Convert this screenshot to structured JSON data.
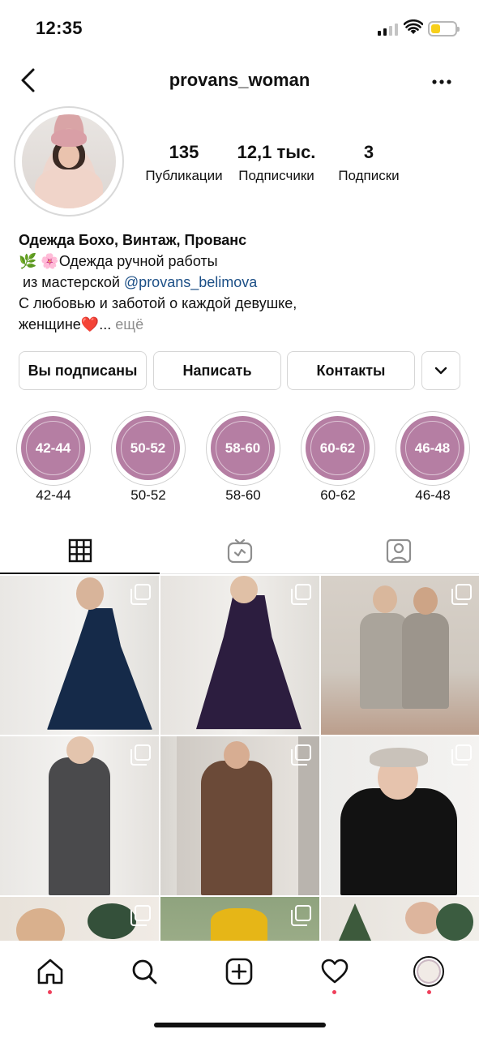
{
  "status_bar": {
    "time": "12:35"
  },
  "header": {
    "username": "provans_woman"
  },
  "stats": [
    {
      "value": "135",
      "label": "Публикации"
    },
    {
      "value": "12,1 тыс.",
      "label": "Подписчики"
    },
    {
      "value": "3",
      "label": "Подписки"
    }
  ],
  "bio": {
    "name": "Одежда Бохо, Винтаж, Прованс",
    "line1_emoji": "🌿 🌸",
    "line1_text": "Одежда ручной работы",
    "line2_text": " из мастерской ",
    "line2_mention": "@provans_belimova",
    "line3": "С любовью и заботой о каждой девушке,",
    "line4_text": "женщине",
    "line4_emoji": "❤️",
    "line4_ellipsis": "... ",
    "more": "ещё"
  },
  "buttons": {
    "following": "Вы подписаны",
    "message": "Написать",
    "contacts": "Контакты"
  },
  "highlights": [
    {
      "title": "42-44",
      "label": "42-44"
    },
    {
      "title": "50-52",
      "label": "50-52"
    },
    {
      "title": "58-60",
      "label": "58-60"
    },
    {
      "title": "60-62",
      "label": "60-62"
    },
    {
      "title": "46-48",
      "label": "46-48"
    }
  ],
  "tabs": [
    "grid-icon",
    "igtv-icon",
    "tagged-icon"
  ],
  "posts": [
    {
      "desc": "navy velvet dress",
      "multi": true
    },
    {
      "desc": "purple velvet dress",
      "multi": true
    },
    {
      "desc": "two women checked dresses",
      "multi": true
    },
    {
      "desc": "grey knit top and skirt",
      "multi": true
    },
    {
      "desc": "brown dress mirror selfie",
      "multi": true
    },
    {
      "desc": "black sweater and cap",
      "multi": true
    },
    {
      "desc": "christmas wreath portrait",
      "multi": true
    },
    {
      "desc": "yellow top",
      "multi": true
    },
    {
      "desc": "woman with christmas tree",
      "multi": false
    }
  ],
  "bottom_nav": [
    "home-icon",
    "search-icon",
    "create-icon",
    "activity-icon",
    "profile-avatar"
  ],
  "colors": {
    "highlight": "#b57ea3",
    "mention": "#1c4f86",
    "notification_dot": "#ef3f5a",
    "battery": "#f7cf1b"
  }
}
